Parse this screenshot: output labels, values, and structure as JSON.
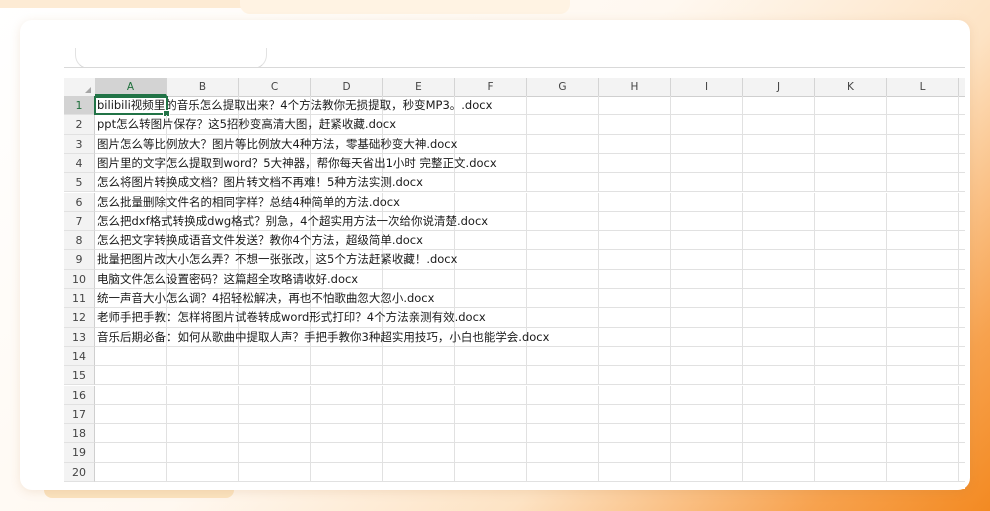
{
  "sheet": {
    "columns": [
      "A",
      "B",
      "C",
      "D",
      "E",
      "F",
      "G",
      "H",
      "I",
      "J",
      "K",
      "L"
    ],
    "selected_column": "A",
    "selected_row": 1,
    "row_numbers": [
      "1",
      "2",
      "3",
      "4",
      "5",
      "6",
      "7",
      "8",
      "9",
      "10",
      "11",
      "12",
      "13",
      "14",
      "15",
      "16",
      "17",
      "18",
      "19",
      "20"
    ],
    "cells": [
      "bilibili视频里的音乐怎么提取出来？4个方法教你无损提取，秒变MP3。.docx",
      "ppt怎么转图片保存？这5招秒变高清大图，赶紧收藏.docx",
      "图片怎么等比例放大？图片等比例放大4种方法，零基础秒变大神.docx",
      "图片里的文字怎么提取到word？5大神器，帮你每天省出1小时 完整正文.docx",
      "怎么将图片转换成文档？图片转文档不再难！5种方法实测.docx",
      "怎么批量删除文件名的相同字样？总结4种简单的方法.docx",
      "怎么把dxf格式转换成dwg格式？别急，4个超实用方法一次给你说清楚.docx",
      "怎么把文字转换成语音文件发送？教你4个方法，超级简单.docx",
      "批量把图片改大小怎么弄？不想一张张改，这5个方法赶紧收藏！.docx",
      "电脑文件怎么设置密码？这篇超全攻略请收好.docx",
      "统一声音大小怎么调？4招轻松解决，再也不怕歌曲忽大忽小.docx",
      "老师手把手教：怎样将图片试卷转成word形式打印？4个方法亲测有效.docx",
      "音乐后期必备：如何从歌曲中提取人声？手把手教你3种超实用技巧，小白也能学会.docx",
      "",
      "",
      "",
      "",
      "",
      "",
      ""
    ]
  },
  "colors": {
    "accent": "#217346",
    "header_bg": "#f3f3f3",
    "background_orange": "#f38a22"
  }
}
